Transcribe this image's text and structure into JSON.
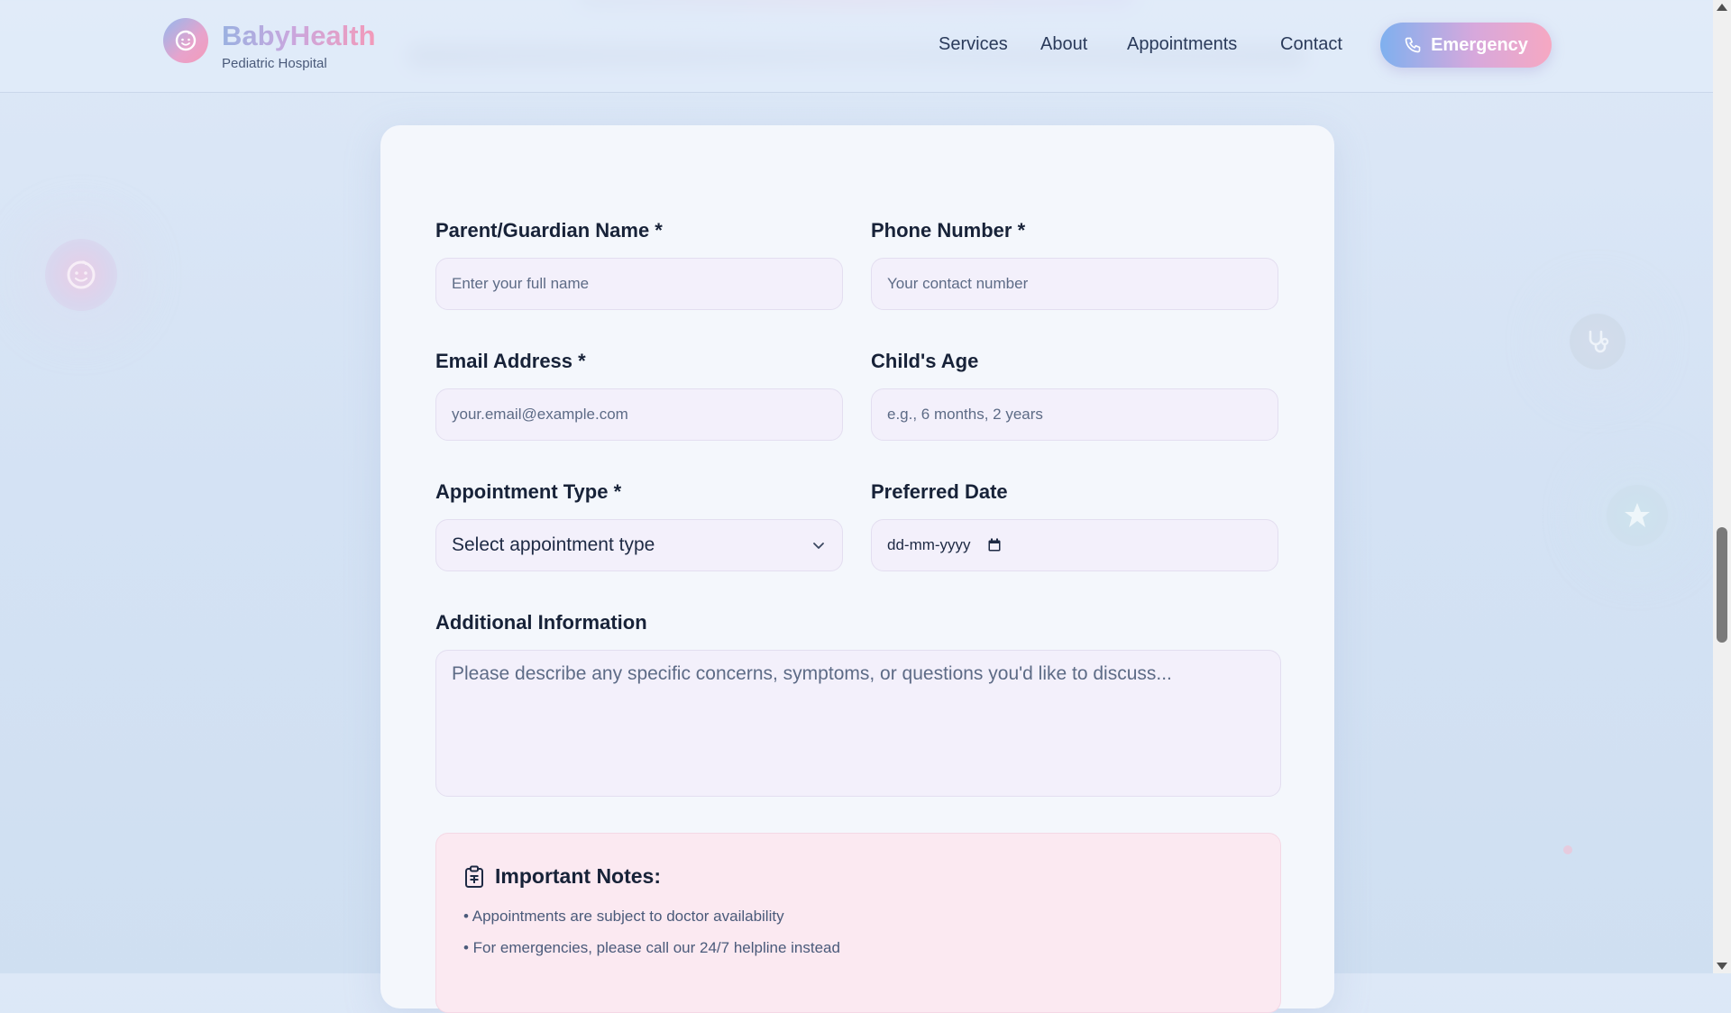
{
  "header": {
    "brand_title": "BabyHealth",
    "brand_subtitle": "Pediatric Hospital",
    "logo_icon": "baby-face-icon",
    "nav": [
      {
        "label": "Services"
      },
      {
        "label": "About"
      },
      {
        "label": "Appointments"
      },
      {
        "label": "Contact"
      }
    ],
    "emergency_label": "Emergency",
    "emergency_icon": "phone-icon"
  },
  "form": {
    "parent_name": {
      "label": "Parent/Guardian Name *",
      "placeholder": "Enter your full name",
      "value": ""
    },
    "phone": {
      "label": "Phone Number *",
      "placeholder": "Your contact number",
      "value": ""
    },
    "email": {
      "label": "Email Address *",
      "placeholder": "your.email@example.com",
      "value": ""
    },
    "child_age": {
      "label": "Child's Age",
      "placeholder": "e.g., 6 months, 2 years",
      "value": ""
    },
    "appointment_type": {
      "label": "Appointment Type *",
      "selected": "Select appointment type"
    },
    "preferred_date": {
      "label": "Preferred Date",
      "value": "dd-mm-yyyy"
    },
    "additional_info": {
      "label": "Additional Information",
      "placeholder": "Please describe any specific concerns, symptoms, or questions you'd like to discuss..."
    }
  },
  "notes": {
    "title": "Important Notes:",
    "icon": "clipboard-icon",
    "items": [
      "• Appointments are subject to doctor availability",
      "• For emergencies, please call our 24/7 helpline instead"
    ]
  },
  "decor": {
    "icons": [
      "baby-face-icon",
      "stethoscope-icon",
      "star-icon"
    ]
  },
  "colors": {
    "brand_pink": "#f39ab9",
    "brand_blue": "#93b8ee",
    "card_bg": "#f4f7fc",
    "field_bg": "#f3f0fb",
    "notes_bg": "#fbe9f1"
  }
}
